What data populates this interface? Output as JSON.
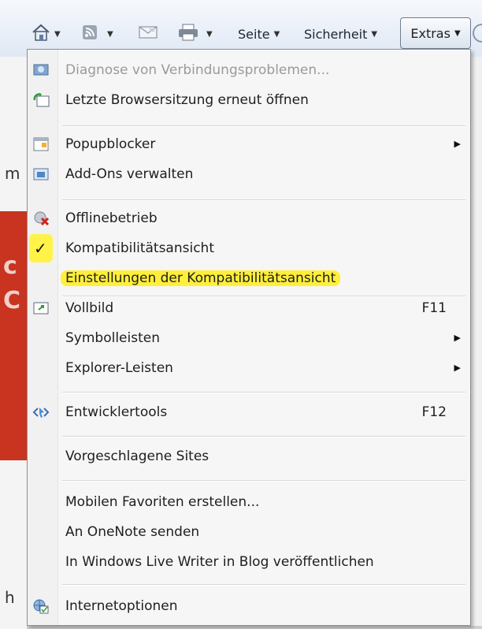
{
  "toolbar": {
    "home_icon": "home-icon",
    "feeds_icon": "rss-feed-icon",
    "mail_icon": "mail-icon",
    "print_icon": "printer-icon",
    "seite_label": "Seite",
    "sicherheit_label": "Sicherheit",
    "extras_label": "Extras"
  },
  "background": {
    "char_m": "m",
    "char_c1": "c",
    "char_c2": "C",
    "char_h": "h"
  },
  "menu": {
    "items": [
      {
        "label": "Diagnose von Verbindungsproblemen...",
        "icon": "network-diagnose-icon",
        "disabled": true
      },
      {
        "label": "Letzte Browsersitzung erneut öffnen",
        "icon": "reopen-session-icon"
      },
      {
        "label": "Popupblocker",
        "icon": "popup-blocker-icon",
        "submenu": true
      },
      {
        "label": "Add-Ons verwalten",
        "icon": "addons-icon"
      },
      {
        "label": "Offlinebetrieb",
        "icon": "offline-icon"
      },
      {
        "label": "Kompatibilitätsansicht",
        "icon": "checkmark-icon",
        "checked": true,
        "check_symbol": "✓"
      },
      {
        "label": "Einstellungen der Kompatibilitätsansicht",
        "highlighted": true
      },
      {
        "label": "Vollbild",
        "icon": "fullscreen-icon",
        "shortcut": "F11"
      },
      {
        "label": "Symbolleisten",
        "submenu": true
      },
      {
        "label": "Explorer-Leisten",
        "submenu": true
      },
      {
        "label": "Entwicklertools",
        "icon": "developer-tools-icon",
        "shortcut": "F12"
      },
      {
        "label": "Vorgeschlagene Sites"
      },
      {
        "label": "Mobilen Favoriten erstellen..."
      },
      {
        "label": "An OneNote senden"
      },
      {
        "label": "In Windows Live Writer in Blog veröffentlichen"
      },
      {
        "label": "Internetoptionen",
        "icon": "internet-options-icon"
      }
    ]
  },
  "colors": {
    "highlight": "#ffef3a",
    "menu_bg": "#f6f6f6",
    "disabled_text": "#9a9a9a",
    "page_red": "#c8341f"
  }
}
